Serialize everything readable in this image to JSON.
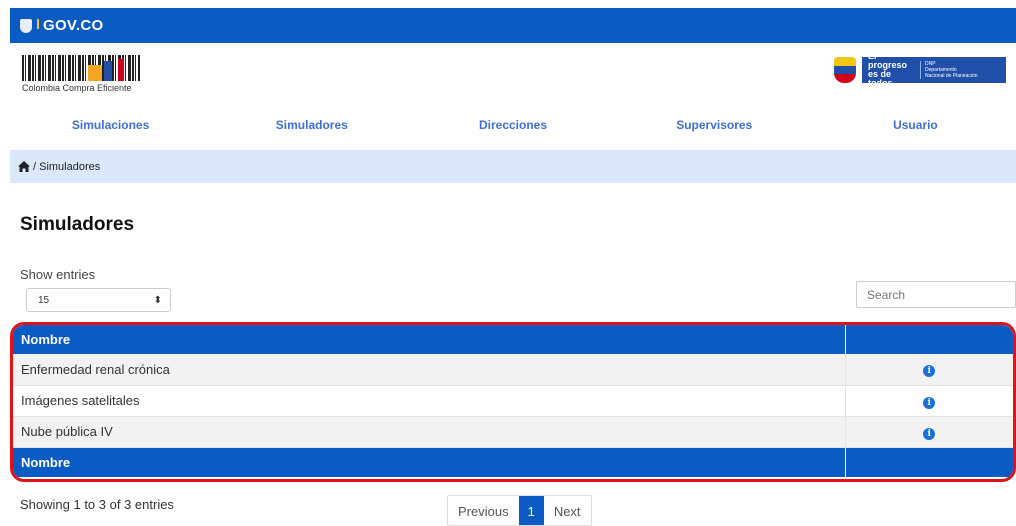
{
  "govbar": {
    "brand": "GOV.CO"
  },
  "header": {
    "logo_text": "Colombia Compra Eficiente",
    "gov_slogan_line1": "El progreso",
    "gov_slogan_line2": "es de todos",
    "dnp_line1": "DNP",
    "dnp_line2": "Departamento",
    "dnp_line3": "Nacional de Planeación"
  },
  "nav": {
    "items": [
      {
        "label": "Simulaciones"
      },
      {
        "label": "Simuladores"
      },
      {
        "label": "Direcciones"
      },
      {
        "label": "Supervisores"
      },
      {
        "label": "Usuario"
      }
    ]
  },
  "breadcrumb": {
    "text": "/ Simuladores"
  },
  "page": {
    "title": "Simuladores"
  },
  "table_controls": {
    "show_entries_label": "Show entries",
    "length_value": "15",
    "search_placeholder": "Search"
  },
  "table": {
    "header": "Nombre",
    "footer": "Nombre",
    "rows": [
      {
        "name": "Enfermedad renal crónica"
      },
      {
        "name": "Imágenes satelitales"
      },
      {
        "name": "Nube pública IV"
      }
    ],
    "info_icon_glyph": "i"
  },
  "pagination": {
    "info": "Showing 1 to 3 of 3 entries",
    "previous": "Previous",
    "current": "1",
    "next": "Next"
  },
  "colors": {
    "primary": "#0b5bc4",
    "highlight_border": "#e0131b",
    "breadcrumb_bg": "#dbe8fb",
    "nav_text": "#3f6fd8"
  }
}
